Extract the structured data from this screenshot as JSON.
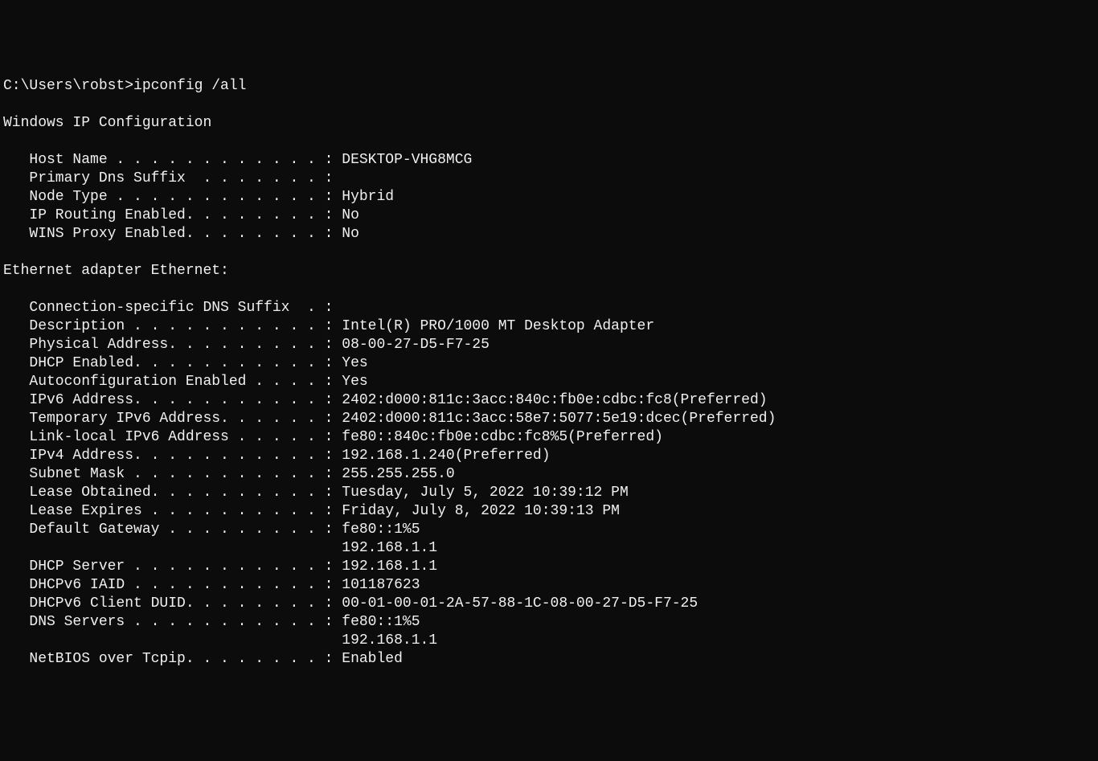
{
  "prompt": "C:\\Users\\robst>",
  "command": "ipconfig /all",
  "section1_header": "Windows IP Configuration",
  "section1": {
    "host_name_label": "   Host Name . . . . . . . . . . . . : ",
    "host_name_value": "DESKTOP-VHG8MCG",
    "primary_dns_label": "   Primary Dns Suffix  . . . . . . . :",
    "primary_dns_value": "",
    "node_type_label": "   Node Type . . . . . . . . . . . . : ",
    "node_type_value": "Hybrid",
    "ip_routing_label": "   IP Routing Enabled. . . . . . . . : ",
    "ip_routing_value": "No",
    "wins_proxy_label": "   WINS Proxy Enabled. . . . . . . . : ",
    "wins_proxy_value": "No"
  },
  "section2_header": "Ethernet adapter Ethernet:",
  "section2": {
    "conn_dns_label": "   Connection-specific DNS Suffix  . :",
    "conn_dns_value": "",
    "description_label": "   Description . . . . . . . . . . . : ",
    "description_value": "Intel(R) PRO/1000 MT Desktop Adapter",
    "physical_label": "   Physical Address. . . . . . . . . : ",
    "physical_value": "08-00-27-D5-F7-25",
    "dhcp_enabled_label": "   DHCP Enabled. . . . . . . . . . . : ",
    "dhcp_enabled_value": "Yes",
    "autoconfig_label": "   Autoconfiguration Enabled . . . . : ",
    "autoconfig_value": "Yes",
    "ipv6_label": "   IPv6 Address. . . . . . . . . . . : ",
    "ipv6_value": "2402:d000:811c:3acc:840c:fb0e:cdbc:fc8(Preferred)",
    "temp_ipv6_label": "   Temporary IPv6 Address. . . . . . : ",
    "temp_ipv6_value": "2402:d000:811c:3acc:58e7:5077:5e19:dcec(Preferred)",
    "linklocal_label": "   Link-local IPv6 Address . . . . . : ",
    "linklocal_value": "fe80::840c:fb0e:cdbc:fc8%5(Preferred)",
    "ipv4_label": "   IPv4 Address. . . . . . . . . . . : ",
    "ipv4_value": "192.168.1.240(Preferred)",
    "subnet_label": "   Subnet Mask . . . . . . . . . . . : ",
    "subnet_value": "255.255.255.0",
    "lease_obtained_label": "   Lease Obtained. . . . . . . . . . : ",
    "lease_obtained_value": "Tuesday, July 5, 2022 10:39:12 PM",
    "lease_expires_label": "   Lease Expires . . . . . . . . . . : ",
    "lease_expires_value": "Friday, July 8, 2022 10:39:13 PM",
    "gateway_label": "   Default Gateway . . . . . . . . . : ",
    "gateway_value1": "fe80::1%5",
    "gateway_indent": "                                       ",
    "gateway_value2": "192.168.1.1",
    "dhcp_server_label": "   DHCP Server . . . . . . . . . . . : ",
    "dhcp_server_value": "192.168.1.1",
    "dhcpv6_iaid_label": "   DHCPv6 IAID . . . . . . . . . . . : ",
    "dhcpv6_iaid_value": "101187623",
    "dhcpv6_duid_label": "   DHCPv6 Client DUID. . . . . . . . : ",
    "dhcpv6_duid_value": "00-01-00-01-2A-57-88-1C-08-00-27-D5-F7-25",
    "dns_servers_label": "   DNS Servers . . . . . . . . . . . : ",
    "dns_servers_value1": "fe80::1%5",
    "dns_servers_indent": "                                       ",
    "dns_servers_value2": "192.168.1.1",
    "netbios_label": "   NetBIOS over Tcpip. . . . . . . . : ",
    "netbios_value": "Enabled"
  }
}
